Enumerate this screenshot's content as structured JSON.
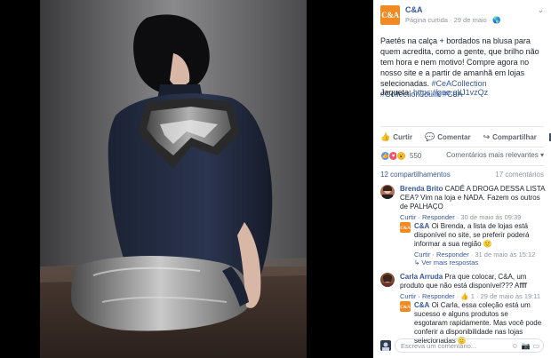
{
  "page": {
    "name": "C&A",
    "logo_text": "C&A"
  },
  "post": {
    "meta": "Página curtida · 29 de maio · 🌎",
    "text": "Paetês na calça + bordados na blusa para quem acredita, como a gente, que brilho não tem hora e nem motivo! Compre agora no nosso site e a partir de amanhã em lojas selecionadas. ",
    "hashtags": "#CeACollection #CollectionJoulik #CeA",
    "link_label": "Jaqueta: ",
    "link_text": "https://goo.gl/J1vzQz"
  },
  "actions": {
    "like": "Curtir",
    "comment": "Comentar",
    "share": "Compartilhar"
  },
  "reactions": {
    "count": "550",
    "relevant_label": "Comentários mais relevantes ▾"
  },
  "stats": {
    "shares": "12 compartilhamentos",
    "comments": "17 comentários"
  },
  "comments": [
    {
      "name": "Brenda Brito",
      "text": " CADÊ A DROGA DESSA LISTA CEA? Vim na loja e NADA. Fazem os outros de PALHAÇO",
      "meta_actions": "Curtir · Responder",
      "meta_date": " · 30 de maio às 09:39",
      "reply": {
        "name": "C&A",
        "text": " Oi Brenda, a lista de lojas está disponível no site, se preferir poderá informar a sua região 🙂",
        "meta_actions": "Curtir · Responder",
        "meta_date": " · 31 de maio às 15:12",
        "more": "↳ Ver mais respostas"
      }
    },
    {
      "name": "Carla Arruda",
      "text": " Pra que colocar, C&A, um produto que não está disponível??? Affff",
      "meta_actions": "Curtir · Responder",
      "meta_date": " · 👍 1 · 29 de maio às 19:11",
      "reply": {
        "name": "C&A",
        "text": " Oi Carla, essa coleção está um sucesso e alguns produtos se esgotaram rapidamente. Mas você pode conferir a disponibilidade nas lojas selecionadas 🙂"
      }
    }
  ],
  "composer": {
    "placeholder": "Escreva um comentário..."
  },
  "colors": {
    "brand": "#f18a22",
    "link": "#365899"
  }
}
